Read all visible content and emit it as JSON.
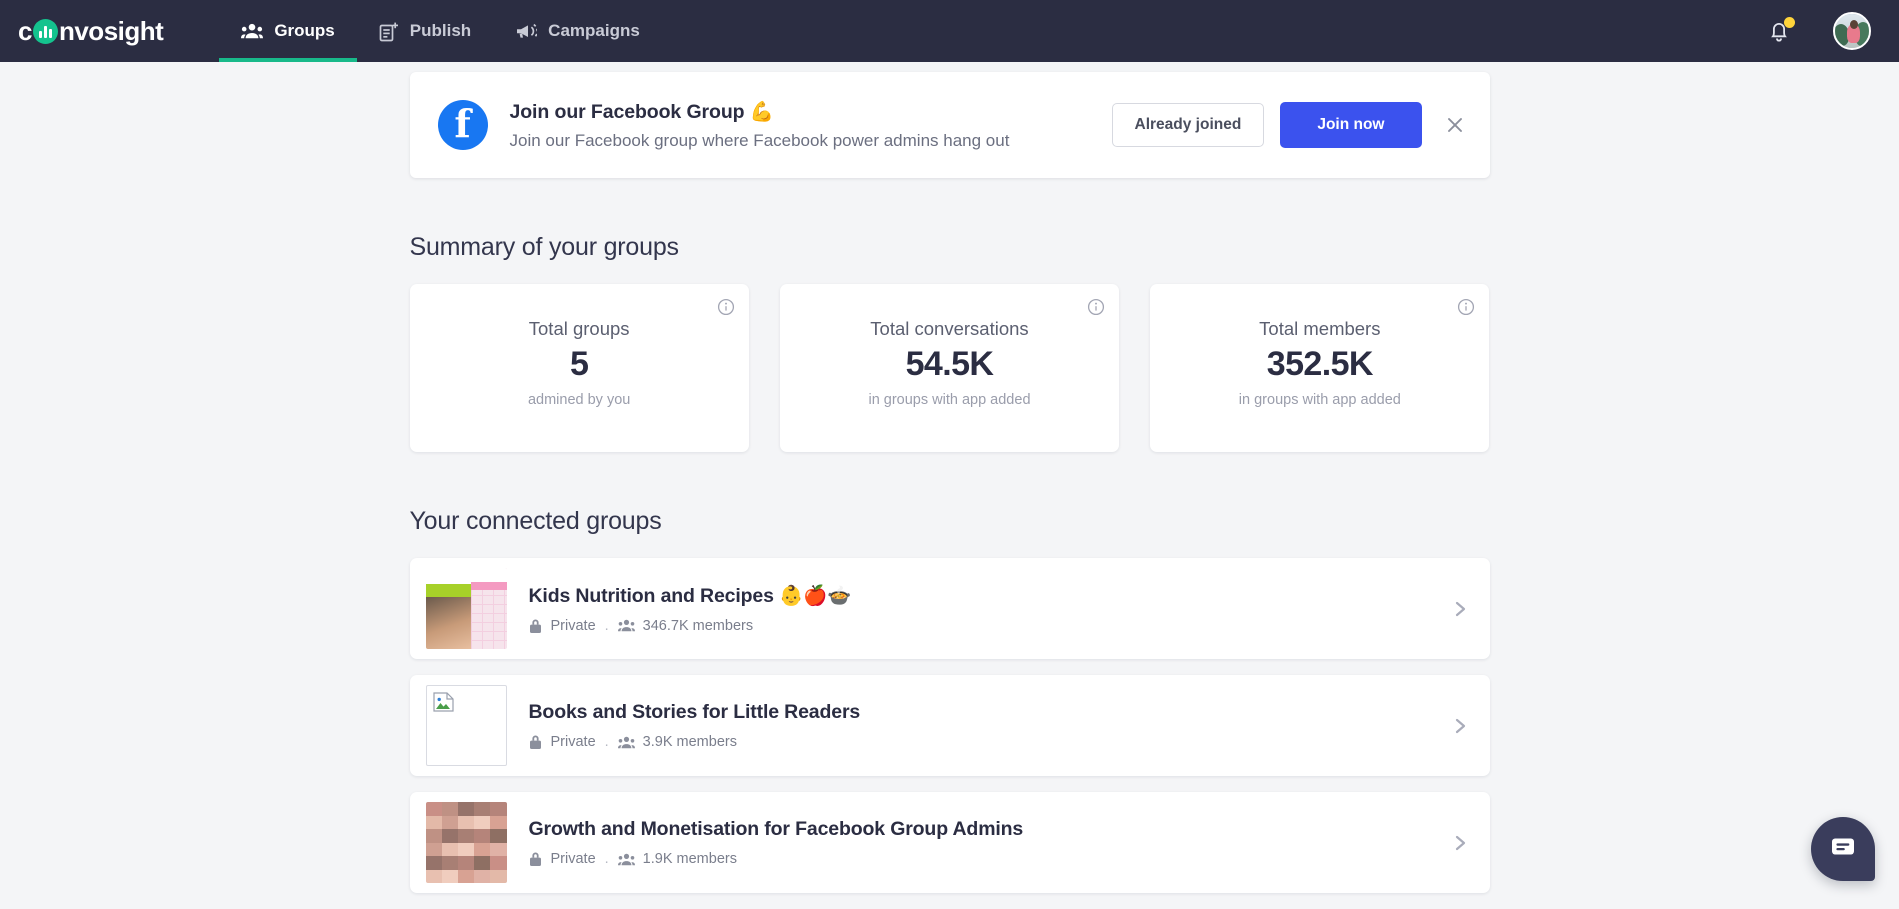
{
  "navbar": {
    "logo_text_before": "c",
    "logo_text_after": "nvosight",
    "logo_name": "convosight",
    "items": [
      {
        "label": "Groups",
        "icon": "people-icon",
        "active": true
      },
      {
        "label": "Publish",
        "icon": "document-plus-icon",
        "active": false
      },
      {
        "label": "Campaigns",
        "icon": "megaphone-icon",
        "active": false
      }
    ],
    "notification_icon": "bell-icon",
    "has_notification": true,
    "avatar_icon": "user-avatar",
    "bg_color": "#2B2D42",
    "active_indicator_color": "#18B98A"
  },
  "banner": {
    "icon": "facebook-icon",
    "title": "Join our Facebook Group 💪",
    "subtitle": "Join our Facebook group where Facebook power admins hang out",
    "secondary_button": "Already joined",
    "primary_button": "Join now",
    "close_icon": "close-icon",
    "primary_color": "#3B52EE"
  },
  "summary": {
    "heading": "Summary of your groups",
    "cards": [
      {
        "label": "Total groups",
        "value": "5",
        "sub": "admined by you",
        "info_icon": "info-icon"
      },
      {
        "label": "Total conversations",
        "value": "54.5K",
        "sub": "in groups with app added",
        "info_icon": "info-icon"
      },
      {
        "label": "Total members",
        "value": "352.5K",
        "sub": "in groups with app added",
        "info_icon": "info-icon"
      }
    ]
  },
  "groups": {
    "heading": "Your connected groups",
    "items": [
      {
        "name": "Kids Nutrition and Recipes 👶🍎🍲",
        "privacy": "Private",
        "separator": ".",
        "members": "346.7K members",
        "thumb": "food-chart-thumbnail",
        "lock_icon": "lock-icon",
        "people_icon": "people-icon",
        "chevron_icon": "chevron-right-icon"
      },
      {
        "name": "Books and Stories for Little Readers",
        "privacy": "Private",
        "separator": ".",
        "members": "3.9K members",
        "thumb": "broken-image-placeholder",
        "lock_icon": "lock-icon",
        "people_icon": "people-icon",
        "chevron_icon": "chevron-right-icon"
      },
      {
        "name": "Growth and Monetisation for Facebook Group Admins",
        "privacy": "Private",
        "separator": ".",
        "members": "1.9K members",
        "thumb": "faces-collage-thumbnail",
        "lock_icon": "lock-icon",
        "people_icon": "people-icon",
        "chevron_icon": "chevron-right-icon"
      }
    ]
  },
  "chat_widget": {
    "icon": "chat-bubble-icon",
    "color": "#3A3D5C"
  }
}
